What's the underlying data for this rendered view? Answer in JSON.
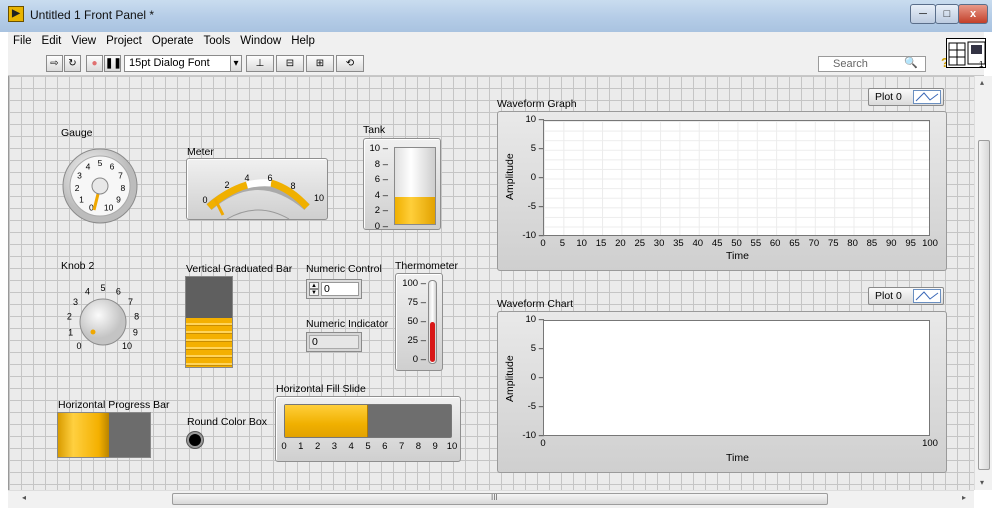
{
  "window": {
    "title": "Untitled 1 Front Panel *",
    "app_icon_glyph": "▶",
    "min_glyph": "─",
    "max_glyph": "□",
    "close_glyph": "x"
  },
  "menubar": {
    "items": [
      "File",
      "Edit",
      "View",
      "Project",
      "Operate",
      "Tools",
      "Window",
      "Help"
    ]
  },
  "toolbar": {
    "run_icon": "⇨",
    "run_continuous_icon": "↻",
    "abort_icon": "●",
    "pause_icon": "❚❚",
    "font_label": "15pt Dialog Font",
    "dropdown_glyph": "▾",
    "align_glyph": "⊥",
    "distribute_glyph": "⊟",
    "resize_glyph": "⊞",
    "reorder_glyph": "⟲",
    "search_placeholder": "Search",
    "search_icon": "🔍",
    "help_glyph": "?"
  },
  "controls": {
    "gauge": {
      "label": "Gauge",
      "ticks": [
        "0",
        "1",
        "2",
        "3",
        "4",
        "5",
        "6",
        "7",
        "8",
        "9",
        "10"
      ],
      "value": 0
    },
    "meter": {
      "label": "Meter",
      "ticks": [
        "0",
        "2",
        "4",
        "6",
        "8",
        "10"
      ],
      "value": 0
    },
    "tank": {
      "label": "Tank",
      "ticks": [
        "10",
        "8",
        "6",
        "4",
        "2",
        "0"
      ],
      "level": 0.36
    },
    "knob": {
      "label": "Knob 2",
      "ticks": [
        "0",
        "1",
        "2",
        "3",
        "4",
        "5",
        "6",
        "7",
        "8",
        "9",
        "10"
      ],
      "value": 0
    },
    "vbar": {
      "label": "Vertical Graduated Bar",
      "level": 0.55
    },
    "numeric_control": {
      "label": "Numeric Control",
      "value": "0",
      "up": "▲",
      "down": "▼"
    },
    "numeric_indicator": {
      "label": "Numeric Indicator",
      "value": "0"
    },
    "thermometer": {
      "label": "Thermometer",
      "ticks": [
        "100",
        "75",
        "50",
        "25",
        "0"
      ],
      "level": 0.5
    },
    "hprogress": {
      "label": "Horizontal Progress Bar",
      "level": 0.55
    },
    "color_box": {
      "label": "Round Color Box",
      "color": "#000000"
    },
    "hslide": {
      "label": "Horizontal Fill Slide",
      "ticks": [
        "0",
        "1",
        "2",
        "3",
        "4",
        "5",
        "6",
        "7",
        "8",
        "9",
        "10"
      ],
      "level": 0.5
    }
  },
  "graph": {
    "title": "Waveform Graph",
    "plot_legend": "Plot 0",
    "ylabel": "Amplitude",
    "xlabel": "Time",
    "y_ticks": [
      "10",
      "5",
      "0",
      "-5",
      "-10"
    ],
    "x_ticks": [
      "0",
      "5",
      "10",
      "15",
      "20",
      "25",
      "30",
      "35",
      "40",
      "45",
      "50",
      "55",
      "60",
      "65",
      "70",
      "75",
      "80",
      "85",
      "90",
      "95",
      "100"
    ]
  },
  "chart": {
    "title": "Waveform Chart",
    "plot_legend": "Plot 0",
    "ylabel": "Amplitude",
    "xlabel": "Time",
    "y_ticks": [
      "10",
      "5",
      "0",
      "-5",
      "-10"
    ],
    "x_ticks": [
      "0",
      "100"
    ]
  },
  "scroll": {
    "h_grip": "III",
    "left": "◂",
    "right": "▸",
    "up": "▴",
    "down": "▾"
  },
  "colors": {
    "fill": "#f4b000",
    "fill_light": "#ffd04a",
    "track": "#6e6e6e",
    "thermo": "#d81818"
  }
}
